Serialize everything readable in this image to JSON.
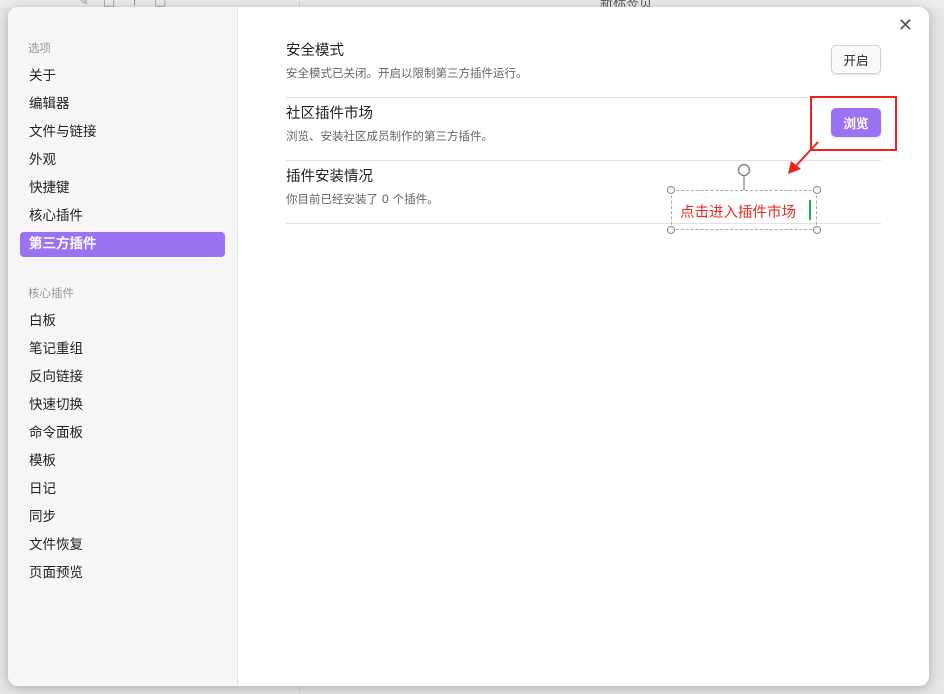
{
  "background": {
    "tab_title": "新标签页"
  },
  "sidebar": {
    "group1": "选项",
    "options": [
      "关于",
      "编辑器",
      "文件与链接",
      "外观",
      "快捷键",
      "核心插件",
      "第三方插件"
    ],
    "active": "第三方插件",
    "group2": "核心插件",
    "core_plugins": [
      "白板",
      "笔记重组",
      "反向链接",
      "快速切换",
      "命令面板",
      "模板",
      "日记",
      "同步",
      "文件恢复",
      "页面预览"
    ]
  },
  "main": {
    "rows": [
      {
        "title": "安全模式",
        "desc": "安全模式已关闭。开启以限制第三方插件运行。",
        "button": "开启"
      },
      {
        "title": "社区插件市场",
        "desc": "浏览、安装社区成员制作的第三方插件。",
        "button": "浏览"
      },
      {
        "title": "插件安装情况",
        "desc": "你目前已经安装了 0 个插件。"
      }
    ]
  },
  "annotation": {
    "text": "点击进入插件市场",
    "color": "#f02a1e"
  },
  "colors": {
    "accent": "#9a72f2",
    "highlight": "#f0201c"
  }
}
